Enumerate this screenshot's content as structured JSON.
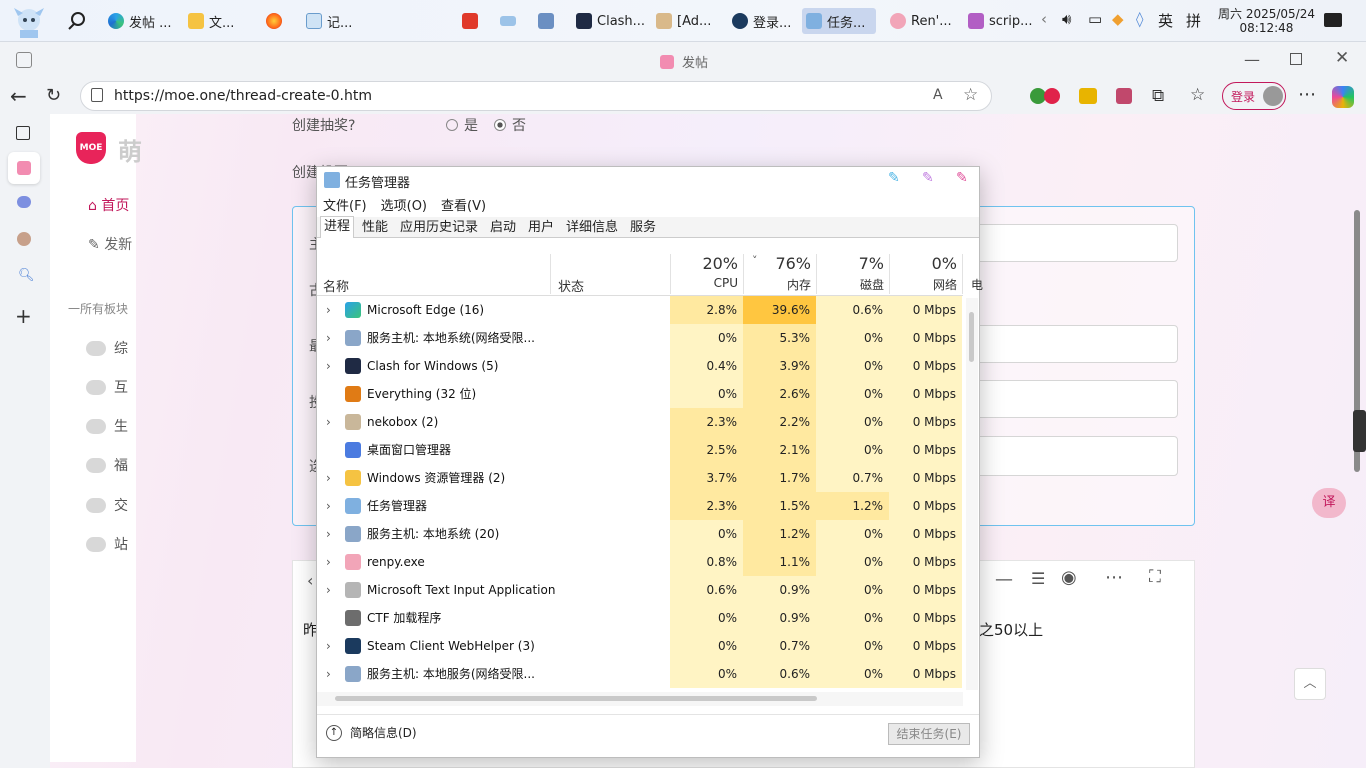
{
  "taskbar": {
    "apps": [
      {
        "label": "",
        "icon": "mascot-icon"
      },
      {
        "label": "",
        "icon": "search-icon"
      },
      {
        "label": "发帖 ...",
        "icon": "edge-icon"
      },
      {
        "label": "文...",
        "icon": "folder-icon"
      },
      {
        "label": "",
        "icon": "firefox-icon"
      },
      {
        "label": "记...",
        "icon": "notepad-icon"
      },
      {
        "label": "",
        "icon": "wps-icon"
      },
      {
        "label": "",
        "icon": "keyboard-icon"
      },
      {
        "label": "",
        "icon": "app-icon"
      },
      {
        "label": "Clash...",
        "icon": "clash-icon"
      },
      {
        "label": "[Ad...",
        "icon": "app2-icon"
      },
      {
        "label": "登录...",
        "icon": "steam-icon"
      },
      {
        "label": "任务...",
        "icon": "taskmgr-icon"
      },
      {
        "label": "Ren'...",
        "icon": "renpy-icon"
      },
      {
        "label": "scrip...",
        "icon": "script-icon"
      }
    ],
    "ime": "英",
    "ime2": "拼",
    "date_line1": "周六 2025/05/24",
    "date_line2": "08:12:48"
  },
  "browser": {
    "title": "发帖",
    "url": "https://moe.one/thread-create-0.htm",
    "login_label": "登录"
  },
  "site": {
    "logo_text": "MOE",
    "logo_char": "萌",
    "nav": [
      {
        "label": "首页",
        "icon": "home-icon"
      },
      {
        "label": "发新",
        "icon": "edit-icon"
      }
    ],
    "boards_header": "一所有板块",
    "boards": [
      "综",
      "互",
      "生",
      "福",
      "交",
      "站"
    ]
  },
  "form": {
    "lottery_label": "创建抽奖?",
    "yes": "是",
    "no": "否",
    "vote_label": "创建投票?",
    "label_a": "主",
    "label_b": "古",
    "label_c": "最",
    "label_d": "投",
    "label_e": "选",
    "editor_text_left": "昨",
    "editor_text_right": "之50以上"
  },
  "taskmgr": {
    "title": "任务管理器",
    "menu": [
      "文件(F)",
      "选项(O)",
      "查看(V)"
    ],
    "tabs": [
      "进程",
      "性能",
      "应用历史记录",
      "启动",
      "用户",
      "详细信息",
      "服务"
    ],
    "columns": {
      "name": "名称",
      "status": "状态",
      "cpu_pct": "20%",
      "cpu": "CPU",
      "mem_pct": "76%",
      "mem": "内存",
      "disk_pct": "7%",
      "disk": "磁盘",
      "net_pct": "0%",
      "net": "网络",
      "extra": "电"
    },
    "processes": [
      {
        "name": "Microsoft Edge (16)",
        "cpu": "2.8%",
        "mem": "39.6%",
        "disk": "0.6%",
        "net": "0 Mbps",
        "expand": true,
        "icon": "edge-icon"
      },
      {
        "name": "服务主机: 本地系统(网络受限...",
        "cpu": "0%",
        "mem": "5.3%",
        "disk": "0%",
        "net": "0 Mbps",
        "expand": true,
        "icon": "gear-icon"
      },
      {
        "name": "Clash for Windows (5)",
        "cpu": "0.4%",
        "mem": "3.9%",
        "disk": "0%",
        "net": "0 Mbps",
        "expand": true,
        "icon": "clash-icon"
      },
      {
        "name": "Everything (32 位)",
        "cpu": "0%",
        "mem": "2.6%",
        "disk": "0%",
        "net": "0 Mbps",
        "expand": false,
        "icon": "magnifier-icon"
      },
      {
        "name": "nekobox (2)",
        "cpu": "2.3%",
        "mem": "2.2%",
        "disk": "0%",
        "net": "0 Mbps",
        "expand": true,
        "icon": "nekobox-icon"
      },
      {
        "name": "桌面窗口管理器",
        "cpu": "2.5%",
        "mem": "2.1%",
        "disk": "0%",
        "net": "0 Mbps",
        "expand": false,
        "icon": "dwm-icon"
      },
      {
        "name": "Windows 资源管理器 (2)",
        "cpu": "3.7%",
        "mem": "1.7%",
        "disk": "0.7%",
        "net": "0 Mbps",
        "expand": true,
        "icon": "folder-icon"
      },
      {
        "name": "任务管理器",
        "cpu": "2.3%",
        "mem": "1.5%",
        "disk": "1.2%",
        "net": "0 Mbps",
        "expand": true,
        "icon": "taskmgr-icon"
      },
      {
        "name": "服务主机: 本地系统 (20)",
        "cpu": "0%",
        "mem": "1.2%",
        "disk": "0%",
        "net": "0 Mbps",
        "expand": true,
        "icon": "gear-icon"
      },
      {
        "name": "renpy.exe",
        "cpu": "0.8%",
        "mem": "1.1%",
        "disk": "0%",
        "net": "0 Mbps",
        "expand": true,
        "icon": "renpy-icon"
      },
      {
        "name": "Microsoft Text Input Application",
        "cpu": "0.6%",
        "mem": "0.9%",
        "disk": "0%",
        "net": "0 Mbps",
        "expand": true,
        "icon": "keyboard-icon"
      },
      {
        "name": "CTF 加载程序",
        "cpu": "0%",
        "mem": "0.9%",
        "disk": "0%",
        "net": "0 Mbps",
        "expand": false,
        "icon": "ctf-icon"
      },
      {
        "name": "Steam Client WebHelper (3)",
        "cpu": "0%",
        "mem": "0.7%",
        "disk": "0%",
        "net": "0 Mbps",
        "expand": true,
        "icon": "steam-icon"
      },
      {
        "name": "服务主机: 本地服务(网络受限...",
        "cpu": "0%",
        "mem": "0.6%",
        "disk": "0%",
        "net": "0 Mbps",
        "expand": true,
        "icon": "gear-icon"
      }
    ],
    "fewer_details": "简略信息(D)",
    "end_task": "结束任务(E)"
  },
  "colors": {
    "accent": "#c2185b",
    "cell_light": "#fff4c4",
    "cell_medium": "#ffe9a0",
    "cell_hot": "#ffc640"
  }
}
